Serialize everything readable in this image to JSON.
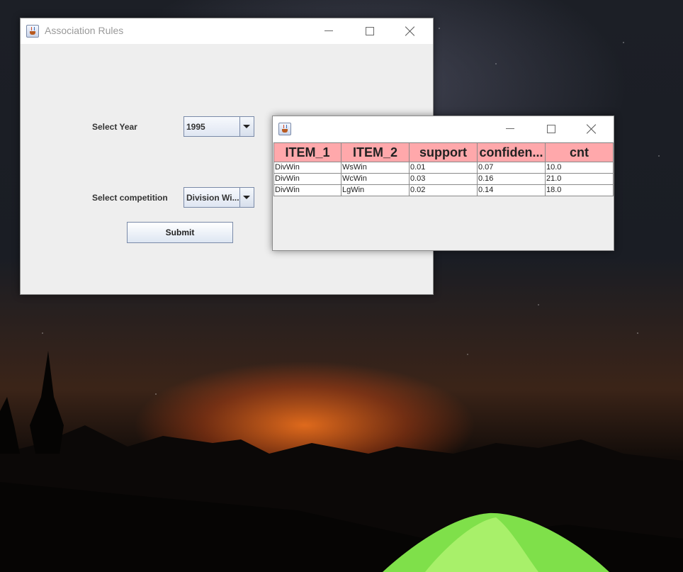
{
  "main_window": {
    "title": "Association Rules",
    "year_label": "Select Year",
    "year_value": "1995",
    "competition_label": "Select competition",
    "competition_value": "Division Wi...",
    "submit_label": "Submit"
  },
  "results_window": {
    "title": "",
    "table": {
      "columns": [
        "ITEM_1",
        "ITEM_2",
        "support",
        "confiden...",
        "cnt"
      ],
      "rows": [
        [
          "DivWin",
          "WsWin",
          "0.01",
          "0.07",
          "10.0"
        ],
        [
          "DivWin",
          "WcWin",
          "0.03",
          "0.16",
          "21.0"
        ],
        [
          "DivWin",
          "LgWin",
          "0.02",
          "0.14",
          "18.0"
        ]
      ]
    }
  },
  "colors": {
    "header_bg": "#ffa8ab",
    "window_bg": "#eeeeee",
    "titlebar_bg": "#ffffff"
  },
  "icons": {
    "window_icon": "java-coffee-cup-icon",
    "minimize": "minimize-icon",
    "maximize": "maximize-icon",
    "close": "close-icon",
    "dropdown": "chevron-down-icon"
  }
}
